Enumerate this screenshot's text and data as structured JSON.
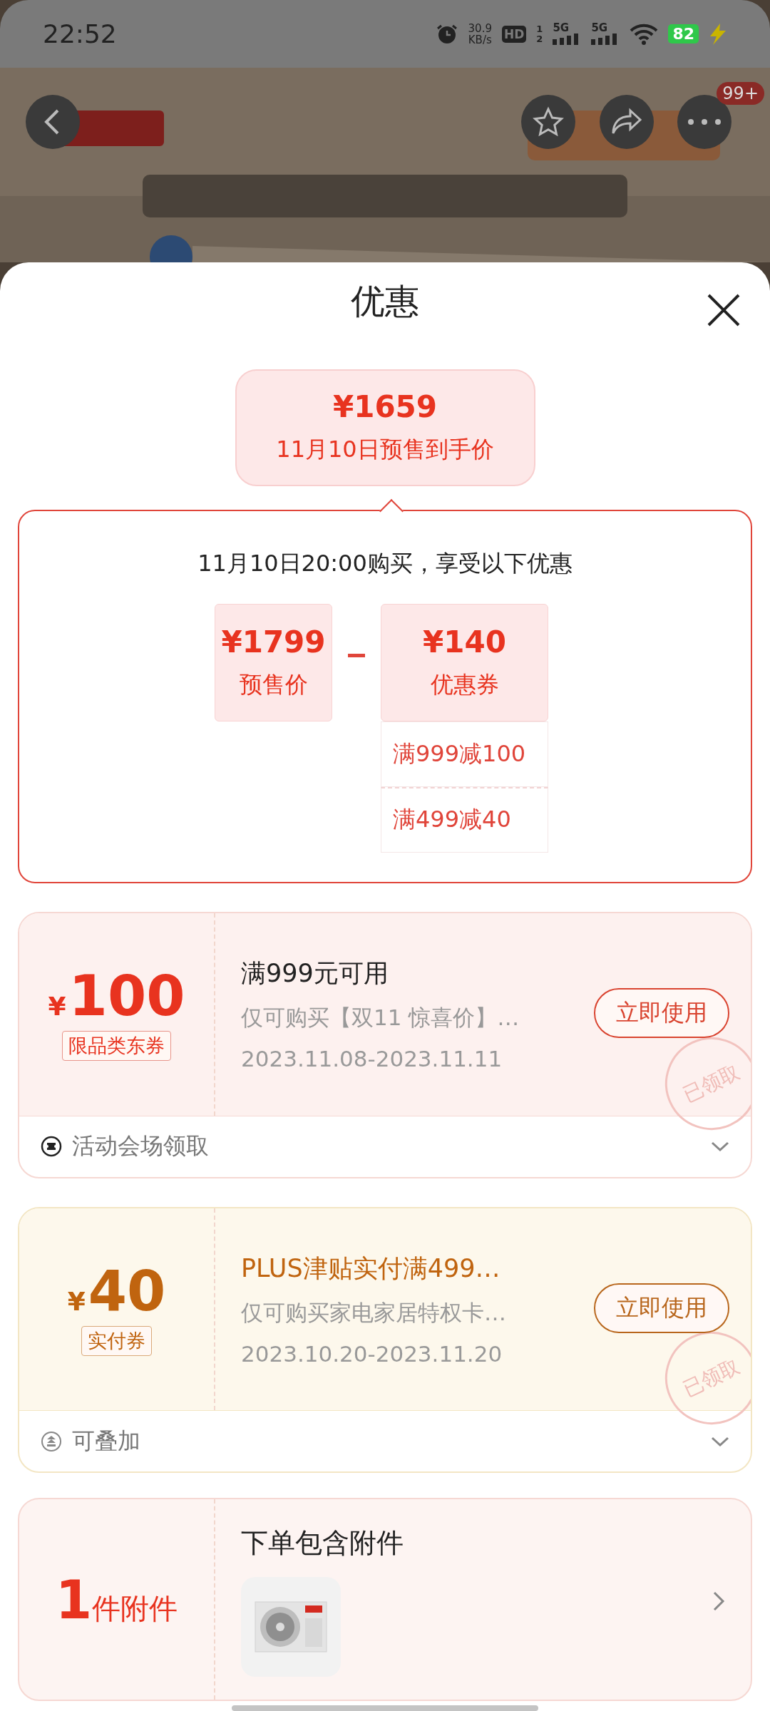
{
  "status_bar": {
    "time": "22:52",
    "net_speed": [
      "30.9",
      "KB/s"
    ],
    "hd": "HD",
    "hd_slots": [
      "1",
      "2"
    ],
    "networks": [
      "5G",
      "5G"
    ],
    "battery": "82"
  },
  "header": {
    "badge": "99+"
  },
  "sheet": {
    "title": "优惠"
  },
  "final_price": {
    "amount": "¥1659",
    "label": "11月10日预售到手价"
  },
  "breakdown": {
    "heading": "11月10日20:00购买，享受以下优惠",
    "presale": {
      "amount": "¥1799",
      "label": "预售价"
    },
    "discount": {
      "amount": "¥140",
      "label": "优惠券",
      "items": [
        "满999减100",
        "满499减40"
      ]
    }
  },
  "coupons": [
    {
      "kind": "jd",
      "currency": "¥",
      "amount": "100",
      "tag": "限品类东券",
      "title": "满999元可用",
      "description": "仅可购买【双11 惊喜价】…",
      "validity": "2023.11.08-2023.11.11",
      "button": "立即使用",
      "stamp": "已领取",
      "footer": "活动会场领取"
    },
    {
      "kind": "plus",
      "currency": "¥",
      "amount": "40",
      "tag": "实付券",
      "title": "PLUS津贴实付满499…",
      "description": "仅可购买家电家居特权卡…",
      "validity": "2023.10.20-2023.11.20",
      "button": "立即使用",
      "stamp": "已领取",
      "footer": "可叠加"
    }
  ],
  "accessory": {
    "count": "1",
    "unit": "件附件",
    "title": "下单包含附件"
  }
}
